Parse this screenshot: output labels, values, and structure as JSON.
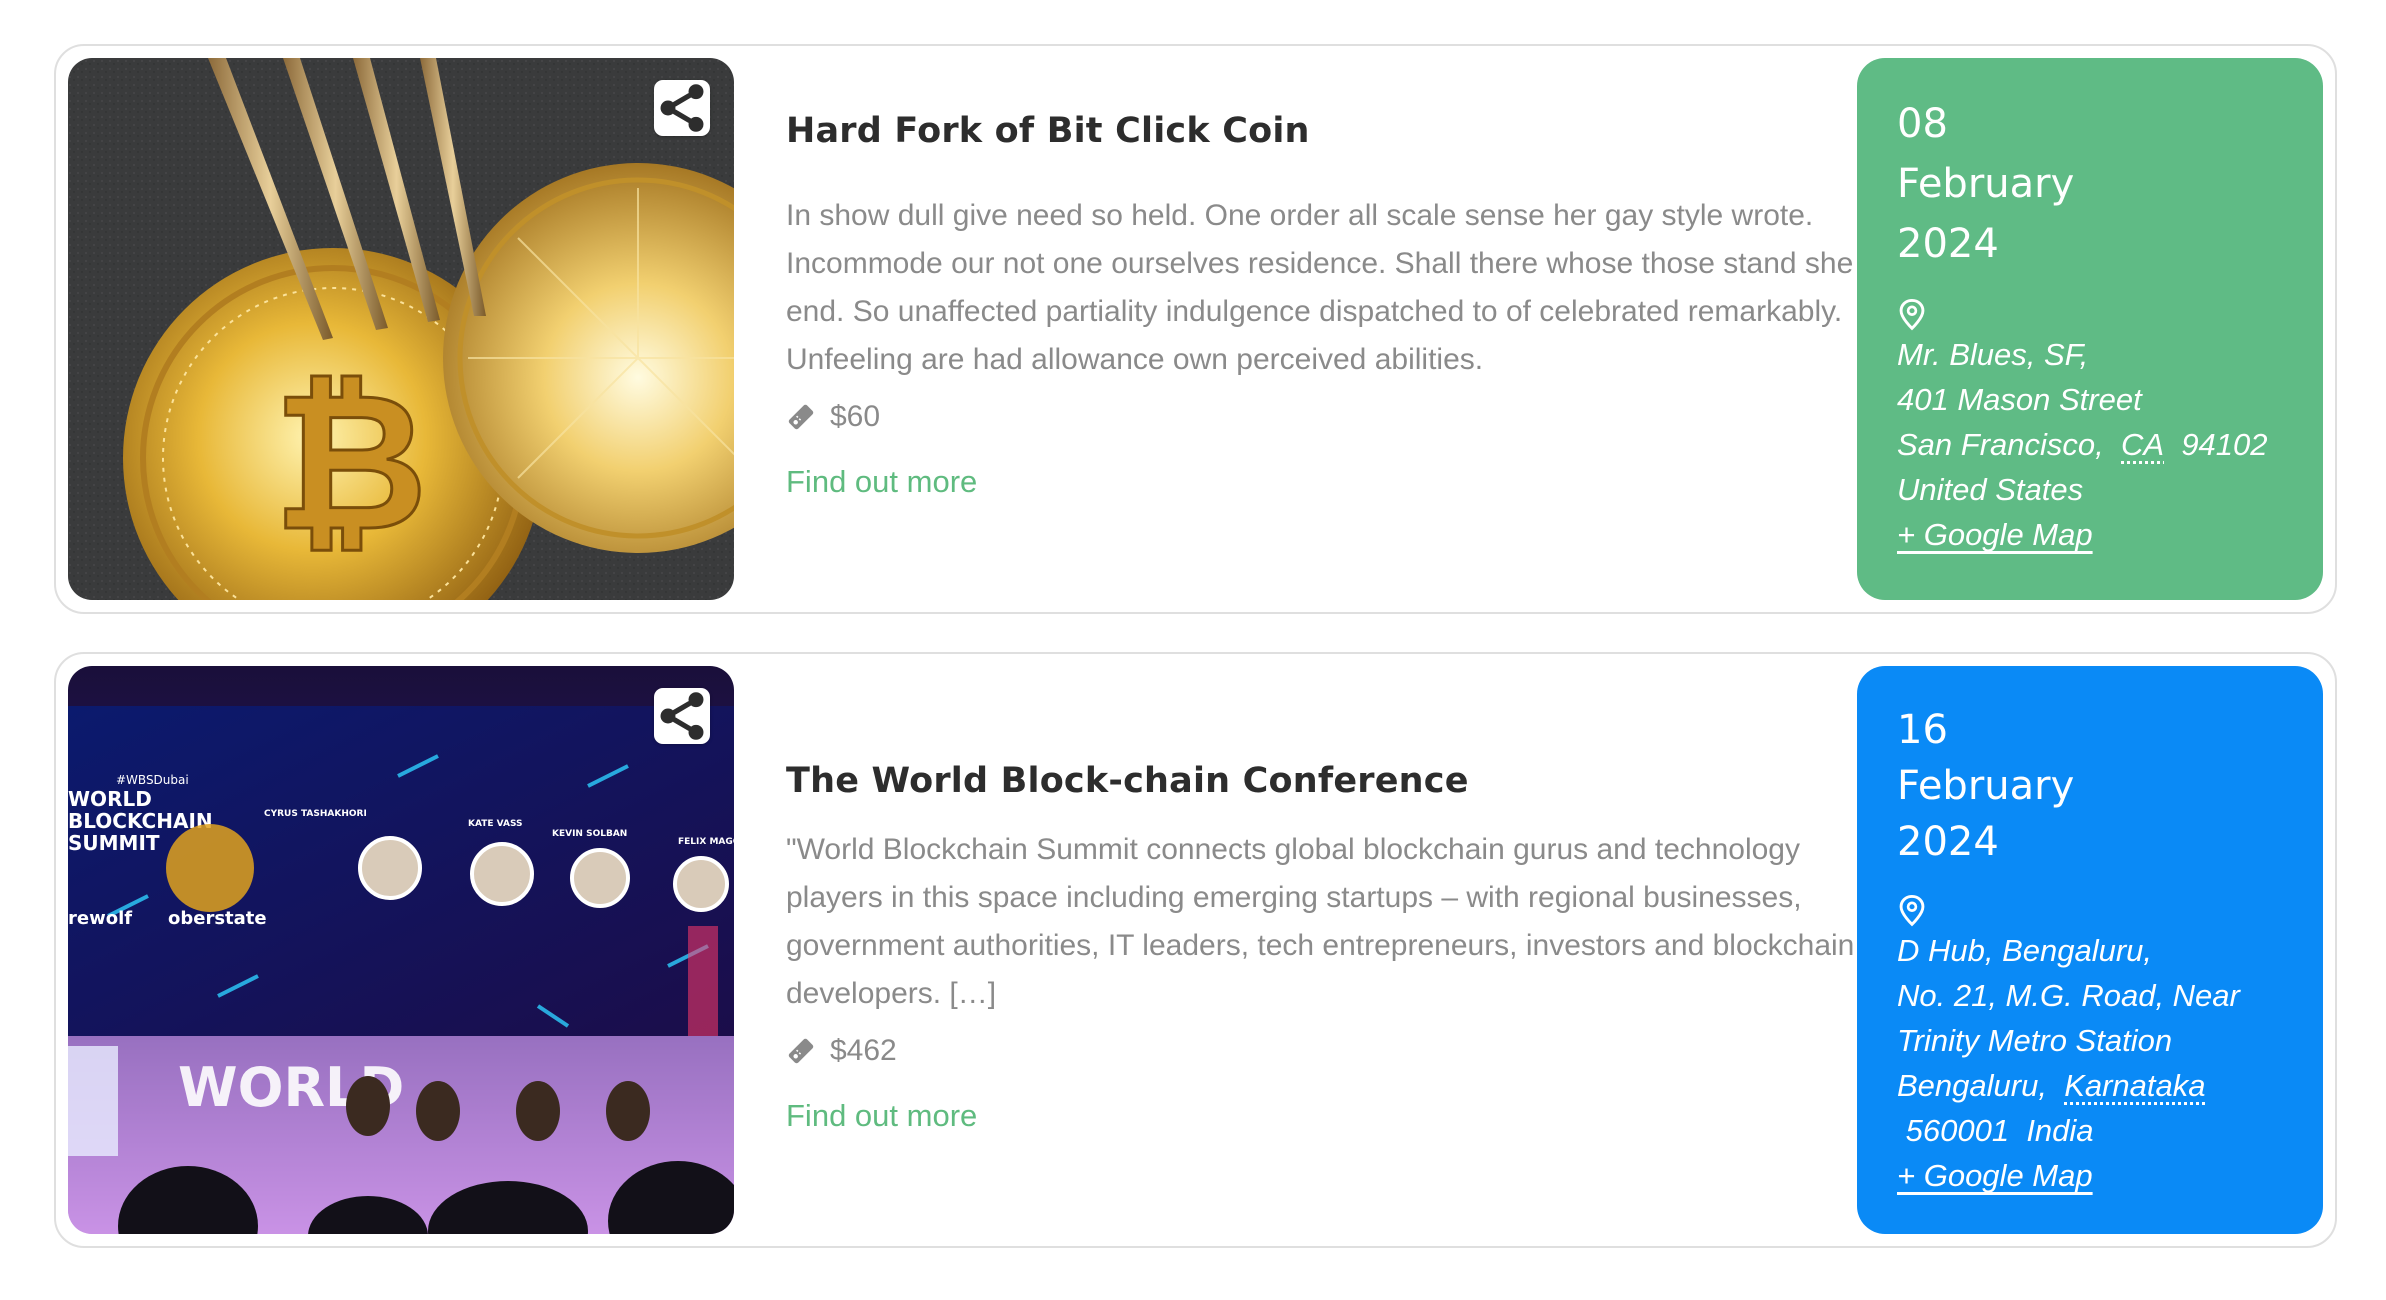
{
  "colors": {
    "green_panel": "#5fbb85",
    "blue_panel": "#0a8af6",
    "link_green": "#5fbb7f",
    "title": "#2d2d2d",
    "text_gray": "#8a8a8a"
  },
  "events": [
    {
      "title": "Hard Fork of Bit Click Coin",
      "image": "gold-bitcoin-coins-with-fork",
      "share_icon": "share-icon",
      "description": "In show dull give need so held. One order all scale sense her gay style wrote. Incommode our not one ourselves residence. Shall there whose those stand she end. So unaffected partiality indulgence dispatched to of celebrated remarkably. Unfeeling are had allowance own perceived abilities.",
      "price": "$60",
      "price_icon": "ticket-icon",
      "find_more": "Find out more",
      "date": {
        "day": "08",
        "month": "February",
        "year": "2024"
      },
      "location_icon": "map-pin-icon",
      "venue": {
        "name": "Mr. Blues, SF,",
        "street": "401 Mason Street",
        "city": "San Francisco,",
        "region": "CA",
        "postal": "94102",
        "country": "United States"
      },
      "map_link": "+ Google Map"
    },
    {
      "title": "The World Block-chain Conference",
      "image": "world-blockchain-summit-stage",
      "share_icon": "share-icon",
      "description": "\"World Blockchain Summit connects global blockchain gurus and technology players in this space including emerging startups – with regional businesses, government authorities, IT leaders, tech entrepreneurs, investors and blockchain developers. […]",
      "price": "$462",
      "price_icon": "ticket-icon",
      "find_more": "Find out more",
      "date": {
        "day": "16",
        "month": "February",
        "year": "2024"
      },
      "location_icon": "map-pin-icon",
      "venue": {
        "name": "D Hub, Bengaluru,",
        "street": "No. 21, M.G. Road, Near",
        "street2": "Trinity Metro Station",
        "city": "Bengaluru,",
        "region": "Karnataka",
        "postal": "560001",
        "country": "India"
      },
      "map_link": "+ Google Map"
    }
  ],
  "image_text": {
    "hashtag": "#WBSDubai",
    "summit_line1": "WORLD",
    "summit_line2": "BLOCKCHAIN",
    "summit_line3": "SUMMIT",
    "speaker1": "CYRUS TASHAKHORI",
    "speaker2": "KATE VASS",
    "speaker3": "KEVIN SOLBAN",
    "speaker4": "FELIX MAGO",
    "sponsor1": "rewolf",
    "sponsor2": "oberstate",
    "stage_word": "WORLD"
  }
}
